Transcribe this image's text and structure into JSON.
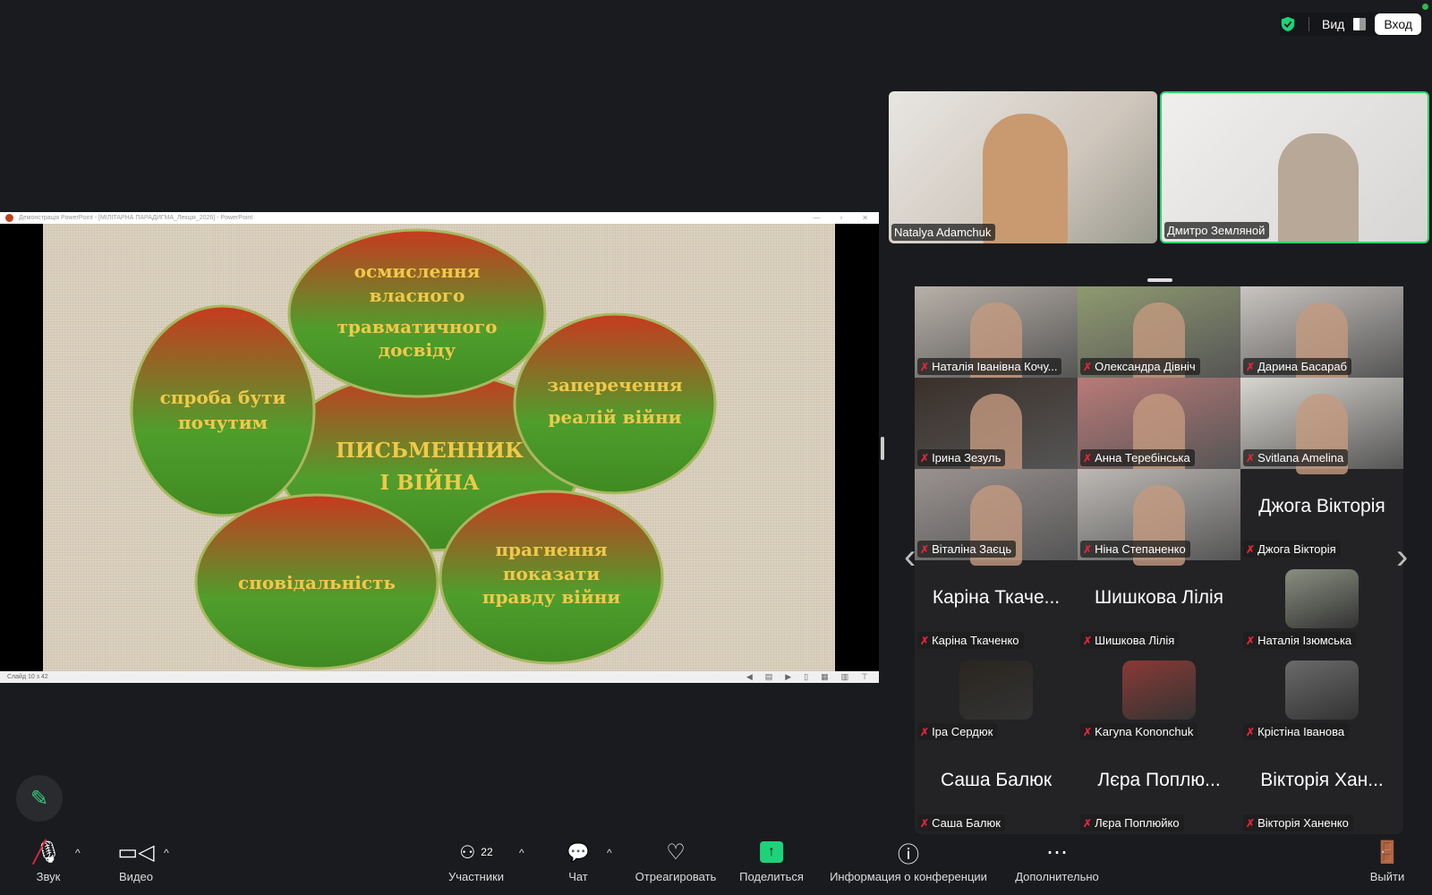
{
  "topbar": {
    "view_label": "Вид",
    "login_label": "Вход"
  },
  "presentation": {
    "window_title": "Демонстрація PowerPoint - [МІЛІТАРНА ПАРАДИГМА_Лекція_2026] - PowerPoint",
    "status": "Слайд 10 з 42",
    "slide": {
      "center": [
        "ПИСЬМЕННИК",
        "І ВІЙНА"
      ],
      "left": [
        "спроба бути",
        "почутим"
      ],
      "top": [
        "осмислення",
        "власного",
        "травматичного",
        "досвіду"
      ],
      "right": [
        "заперечення",
        "реалій війни"
      ],
      "bottom_left": [
        "сповідальність"
      ],
      "bottom_right": [
        "прагнення",
        "показати",
        "правду війни"
      ]
    },
    "colors": {
      "ellipse_top": "#c8391f",
      "ellipse_bottom": "#4f9e2c",
      "text": "#f0c94a"
    }
  },
  "speakers": [
    {
      "name": "Natalya Adamchuk"
    },
    {
      "name": "Дмитро Земляной",
      "active": true
    }
  ],
  "gallery": [
    {
      "type": "video",
      "name": "Наталія Іванівна Кочу...",
      "bg": "#b8b0a8"
    },
    {
      "type": "video",
      "name": "Олександра Дівніч",
      "bg": "#8f9a70"
    },
    {
      "type": "video",
      "name": "Дарина Басараб",
      "bg": "#c9c4c0"
    },
    {
      "type": "video",
      "name": "Ірина Зезуль",
      "bg": "#3b302a"
    },
    {
      "type": "video",
      "name": "Анна Теребінська",
      "bg": "#b97a78"
    },
    {
      "type": "video",
      "name": "Svitlana Amelina",
      "bg": "#d8d6d0"
    },
    {
      "type": "video",
      "name": "Віталіна Заєць",
      "bg": "#9a9290"
    },
    {
      "type": "video",
      "name": "Ніна Степаненко",
      "bg": "#bdb9b5"
    },
    {
      "type": "name",
      "name": "Джога Вікторія",
      "display": "Джога Вікторія"
    },
    {
      "type": "name",
      "name": "Каріна Ткаченко",
      "display": "Каріна Ткаче..."
    },
    {
      "type": "name",
      "name": "Шишкова Лілія",
      "display": "Шишкова Лілія"
    },
    {
      "type": "avatar",
      "name": "Наталія Ізюмська",
      "bg": "#8a8f80"
    },
    {
      "type": "avatar",
      "name": "Іра Сердюк",
      "bg": "#2a2520"
    },
    {
      "type": "avatar",
      "name": "Kaгуna Kononchuk",
      "bg": "#8a3a34"
    },
    {
      "type": "avatar",
      "name": "Крістіна Іванова",
      "bg": "#6a6a6a"
    },
    {
      "type": "name",
      "name": "Саша Балюк",
      "display": "Саша Балюк"
    },
    {
      "type": "name",
      "name": "Лєра Поплюйко",
      "display": "Лєра Поплю..."
    },
    {
      "type": "name",
      "name": "Вікторія Ханенко",
      "display": "Вікторія Хан..."
    }
  ],
  "toolbar": {
    "audio": "Звук",
    "video": "Видео",
    "participants": "Участники",
    "participants_count": "22",
    "chat": "Чат",
    "react": "Отреагировать",
    "share": "Поделиться",
    "info": "Информация о конференции",
    "more": "Дополнительно",
    "leave": "Выйти"
  }
}
